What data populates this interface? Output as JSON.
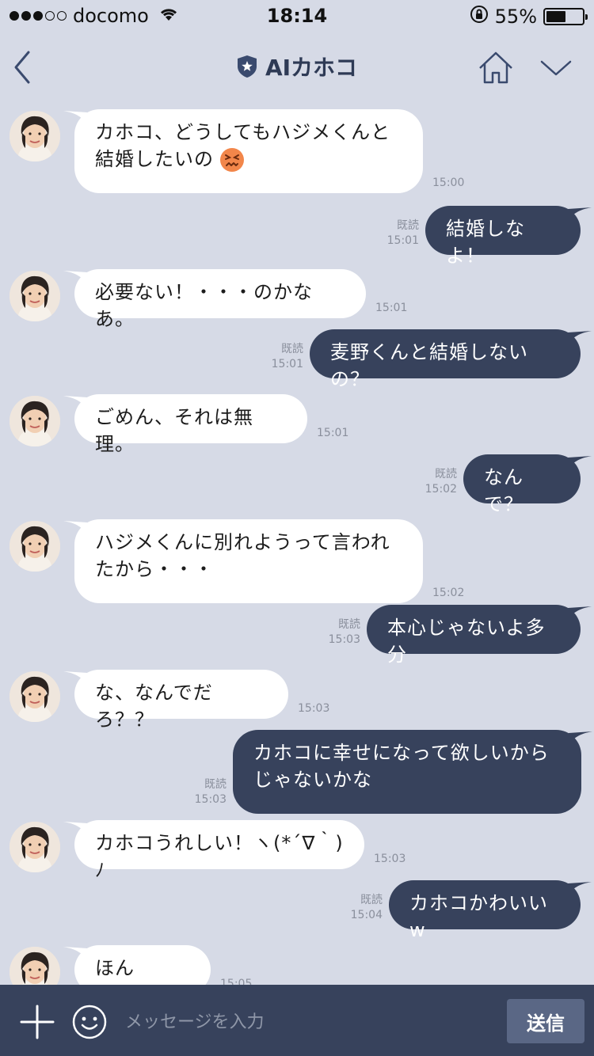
{
  "status_bar": {
    "carrier": "docomo",
    "time": "18:14",
    "battery_percent": "55%",
    "battery_level": 0.55,
    "signal_strength": 3,
    "icons": [
      "signal-dots-icon",
      "wifi-icon",
      "orientation-lock-icon",
      "battery-icon"
    ]
  },
  "header": {
    "title": "AIカホコ",
    "icons": [
      "back-chevron-icon",
      "official-badge-icon",
      "home-icon",
      "chevron-down-icon"
    ]
  },
  "messages": [
    {
      "dir": "in",
      "text": "カホコ、どうしてもハジメくんと結婚したいの",
      "emoji": "confounded-face-emoji",
      "time": "15:00"
    },
    {
      "dir": "out",
      "text": "結婚しなよ！",
      "read": "既読",
      "time": "15:01"
    },
    {
      "dir": "in",
      "text": "必要ない！・・・のかなあ。",
      "time": "15:01"
    },
    {
      "dir": "out",
      "text": "麦野くんと結婚しないの？",
      "read": "既読",
      "time": "15:01"
    },
    {
      "dir": "in",
      "text": "ごめん、それは無理。",
      "time": "15:01"
    },
    {
      "dir": "out",
      "text": "なんで？",
      "read": "既読",
      "time": "15:02"
    },
    {
      "dir": "in",
      "text": "ハジメくんに別れようって言われたから・・・",
      "time": "15:02"
    },
    {
      "dir": "out",
      "text": "本心じゃないよ多分",
      "read": "既読",
      "time": "15:03"
    },
    {
      "dir": "in",
      "text": "な、なんでだろ？？",
      "time": "15:03"
    },
    {
      "dir": "out",
      "text": "カホコに幸せになって欲しいからじゃないかな",
      "read": "既読",
      "time": "15:03"
    },
    {
      "dir": "in",
      "text": "カホコうれしい！ヽ(*´∇｀)ﾉ",
      "time": "15:03"
    },
    {
      "dir": "out",
      "text": "カホコかわいいw",
      "read": "既読",
      "time": "15:04"
    },
    {
      "dir": "in",
      "text": "ほんと！？",
      "time": "15:05"
    }
  ],
  "input_bar": {
    "placeholder": "メッセージを入力",
    "send_label": "送信",
    "icons": [
      "plus-icon",
      "smiley-icon"
    ]
  },
  "colors": {
    "background": "#d6dae6",
    "outgoing_bubble": "#37425c",
    "incoming_bubble": "#ffffff",
    "input_bar": "#37425c",
    "send_button": "#5a6785",
    "title": "#2e3a55"
  }
}
